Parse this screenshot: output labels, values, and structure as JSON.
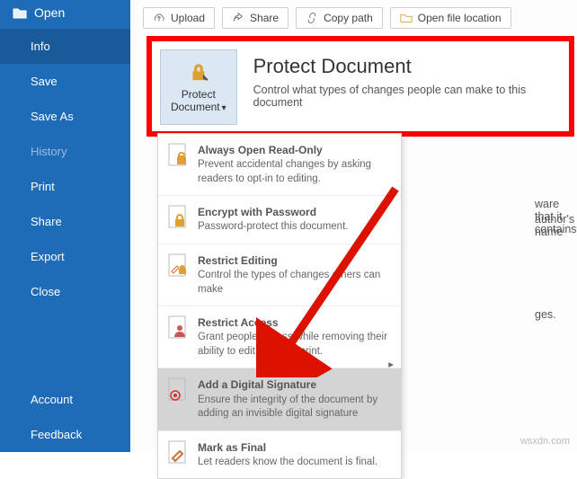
{
  "sidebar": {
    "open": "Open",
    "items": [
      "Info",
      "Save",
      "Save As",
      "History",
      "Print",
      "Share",
      "Export",
      "Close"
    ],
    "bottom": [
      "Account",
      "Feedback"
    ]
  },
  "toolbar": {
    "upload": "Upload",
    "share": "Share",
    "copypath": "Copy path",
    "openloc": "Open file location"
  },
  "protect": {
    "title": "Protect Document",
    "desc": "Control what types of changes people can make to this document",
    "btn_l1": "Protect",
    "btn_l2": "Document"
  },
  "dropdown": [
    {
      "title": "Always Open Read-Only",
      "desc": "Prevent accidental changes by asking readers to opt-in to editing."
    },
    {
      "title": "Encrypt with Password",
      "desc": "Password-protect this document."
    },
    {
      "title": "Restrict Editing",
      "desc": "Control the types of changes others can make"
    },
    {
      "title": "Restrict Access",
      "desc": "Grant people access while removing their ability to edit, copy, or print."
    },
    {
      "title": "Add a Digital Signature",
      "desc": "Ensure the integrity of the document by adding an invisible digital signature"
    },
    {
      "title": "Mark as Final",
      "desc": "Let readers know the document is final."
    }
  ],
  "bg": {
    "l1": "ware that it contains:",
    "l2": "author's name",
    "l3": "ges."
  },
  "watermark": "wsxdn.com"
}
